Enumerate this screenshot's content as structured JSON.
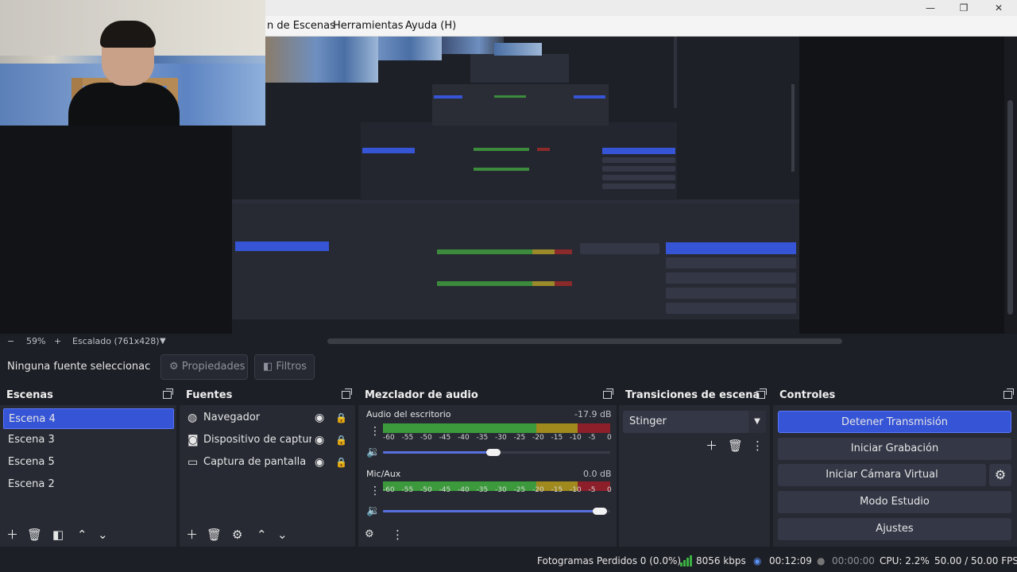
{
  "menu": {
    "items": [
      "n de Escenas",
      "Herramientas",
      "Ayuda (H)"
    ]
  },
  "window": {
    "minimize": "—",
    "restore": "❐",
    "close": "✕"
  },
  "preview": {
    "zoom": "59%",
    "zoom_minus": "−",
    "zoom_plus": "+",
    "scale_label": "Escalado (761x428)"
  },
  "toolbar": {
    "no_source": "Ninguna fuente seleccionac",
    "properties": "Propiedades",
    "filters": "Filtros"
  },
  "scenes": {
    "title": "Escenas",
    "items": [
      "Escena 4",
      "Escena 3",
      "Escena 5",
      "Escena 2"
    ],
    "selected": "Escena 4"
  },
  "sources": {
    "title": "Fuentes",
    "items": [
      {
        "label": "Navegador",
        "icon": "globe-icon"
      },
      {
        "label": "Dispositivo de captura d",
        "icon": "camera-icon"
      },
      {
        "label": "Captura de pantalla",
        "icon": "monitor-icon"
      }
    ]
  },
  "mixer": {
    "title": "Mezclador de audio",
    "channels": [
      {
        "name": "Audio del escritorio",
        "db": "-17.9 dB",
        "volume": 0.5
      },
      {
        "name": "Mic/Aux",
        "db": "0.0 dB",
        "volume": 1.0
      }
    ],
    "ticks": [
      "-60",
      "-55",
      "-50",
      "-45",
      "-40",
      "-35",
      "-30",
      "-25",
      "-20",
      "-15",
      "-10",
      "-5",
      "0"
    ]
  },
  "transitions": {
    "title": "Transiciones de escena",
    "selected": "Stinger"
  },
  "controls": {
    "title": "Controles",
    "stop_stream": "Detener Transmisión",
    "start_recording": "Iniciar Grabación",
    "start_virtual_cam": "Iniciar Cámara Virtual",
    "studio_mode": "Modo Estudio",
    "settings": "Ajustes"
  },
  "status": {
    "dropped_frames": "Fotogramas Perdidos 0 (0.0%)",
    "bitrate": "8056 kbps",
    "stream_time": "00:12:09",
    "rec_time": "00:00:00",
    "cpu": "CPU: 2.2%",
    "fps": "50.00 / 50.00 FPS"
  },
  "colors": {
    "accent": "#3654d6",
    "panel": "#272a33",
    "background": "#1d1f26"
  }
}
